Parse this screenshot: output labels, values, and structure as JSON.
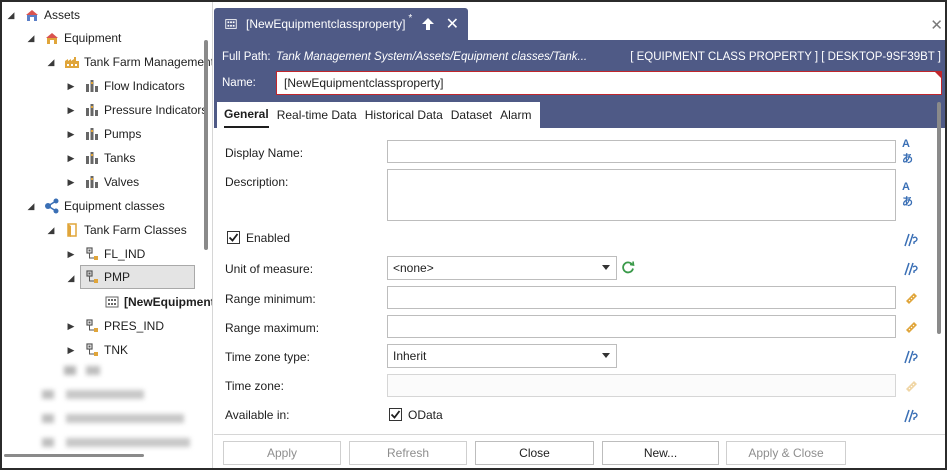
{
  "tree": {
    "items": [
      {
        "label": "Assets",
        "indent": 0,
        "expanded": true,
        "icon": "assets-icon"
      },
      {
        "label": "Equipment",
        "indent": 1,
        "expanded": true,
        "icon": "equipment-icon"
      },
      {
        "label": "Tank Farm Management",
        "indent": 2,
        "expanded": true,
        "icon": "factory-icon"
      },
      {
        "label": "Flow Indicators",
        "indent": 3,
        "expanded": false,
        "icon": "equipment-node-icon"
      },
      {
        "label": "Pressure Indicators",
        "indent": 3,
        "expanded": false,
        "icon": "equipment-node-icon"
      },
      {
        "label": "Pumps",
        "indent": 3,
        "expanded": false,
        "icon": "equipment-node-icon"
      },
      {
        "label": "Tanks",
        "indent": 3,
        "expanded": false,
        "icon": "equipment-node-icon"
      },
      {
        "label": "Valves",
        "indent": 3,
        "expanded": false,
        "icon": "equipment-node-icon"
      },
      {
        "label": "Equipment classes",
        "indent": 1,
        "expanded": true,
        "icon": "equipment-classes-icon"
      },
      {
        "label": "Tank Farm Classes",
        "indent": 2,
        "expanded": true,
        "icon": "folder-icon"
      },
      {
        "label": "FL_IND",
        "indent": 3,
        "expanded": false,
        "icon": "class-icon"
      },
      {
        "label": "PMP",
        "indent": 3,
        "expanded": true,
        "icon": "class-icon",
        "selected": true
      },
      {
        "label": "[NewEquipmentclassproperty]",
        "indent": 4,
        "leaf": true,
        "icon": "property-icon",
        "bold": true
      },
      {
        "label": "PRES_IND",
        "indent": 3,
        "expanded": false,
        "icon": "class-icon"
      },
      {
        "label": "TNK",
        "indent": 3,
        "expanded": false,
        "icon": "class-icon"
      }
    ]
  },
  "doc_tab": {
    "title": "[NewEquipmentclassproperty]",
    "modified_mark": "*"
  },
  "header": {
    "full_path_label": "Full Path:",
    "full_path_value": "Tank Management System/Assets/Equipment classes/Tank...",
    "type_info": "[ EQUIPMENT CLASS PROPERTY ] [ DESKTOP-9SF39BT ]",
    "name_label": "Name:",
    "name_value": "[NewEquipmentclassproperty]"
  },
  "subtabs": [
    "General",
    "Real-time Data",
    "Historical Data",
    "Dataset",
    "Alarm"
  ],
  "form": {
    "display_name_label": "Display Name:",
    "display_name_value": "",
    "description_label": "Description:",
    "description_value": "",
    "enabled_label": "Enabled",
    "enabled_checked": true,
    "unit_label": "Unit of measure:",
    "unit_value": "<none>",
    "range_min_label": "Range minimum:",
    "range_min_value": "",
    "range_max_label": "Range maximum:",
    "range_max_value": "",
    "tz_type_label": "Time zone type:",
    "tz_type_value": "Inherit",
    "tz_label": "Time zone:",
    "tz_value": "",
    "available_label": "Available in:",
    "odata_label": "OData",
    "odata_checked": true,
    "translate_icon_text": "Aあ"
  },
  "buttons": {
    "apply": "Apply",
    "refresh": "Refresh",
    "close": "Close",
    "new": "New...",
    "apply_close": "Apply & Close"
  },
  "colors": {
    "header_bg": "#4f5a86",
    "name_border": "#c0262c",
    "link_icon": "#3a6fb5",
    "ruler_icon": "#e0a53a",
    "refresh_icon": "#3a9a4a"
  }
}
